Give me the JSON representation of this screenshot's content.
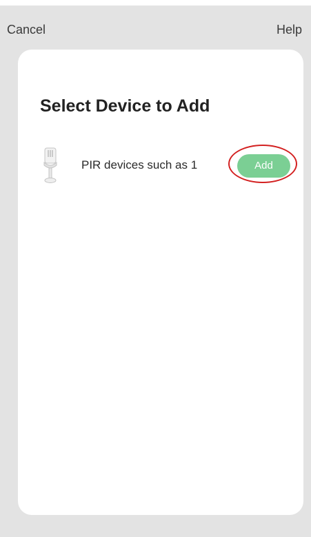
{
  "nav": {
    "cancel_label": "Cancel",
    "help_label": "Help"
  },
  "card": {
    "title": "Select Device to Add"
  },
  "devices": [
    {
      "name": "PIR devices such as 1",
      "icon": "pir-sensor-icon",
      "action_label": "Add",
      "action_color": "#7bcf94",
      "highlighted": true,
      "highlight_color": "#d32020"
    }
  ],
  "colors": {
    "background": "#e3e3e3",
    "card": "#ffffff",
    "text": "#222222"
  }
}
